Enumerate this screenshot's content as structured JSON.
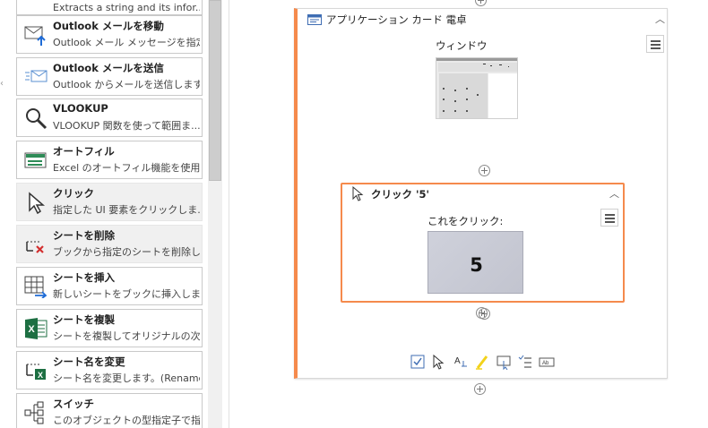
{
  "left_panel": {
    "partial_top_text": "Extracts a string and its infor...",
    "edge_glyph": "‹",
    "activities": [
      {
        "title": "Outlook メールを移動",
        "desc": "Outlook メール メッセージを指定...",
        "icon": "mail-move-icon"
      },
      {
        "title": "Outlook メールを送信",
        "desc": "Outlook からメールを送信します...",
        "icon": "mail-send-icon"
      },
      {
        "title": "VLOOKUP",
        "desc": "VLOOKUP 関数を使って範囲ま...",
        "icon": "magnifier-icon"
      },
      {
        "title": "オートフィル",
        "desc": "Excel のオートフィル機能を使用...",
        "icon": "autofill-icon"
      },
      {
        "title": "クリック",
        "desc": "指定した UI 要素をクリックしま...",
        "icon": "cursor-icon"
      },
      {
        "title": "シートを削除",
        "desc": "ブックから指定のシートを削除し...",
        "icon": "delete-sheet-icon"
      },
      {
        "title": "シートを挿入",
        "desc": "新しいシートをブックに挿入します...",
        "icon": "insert-sheet-icon"
      },
      {
        "title": "シートを複製",
        "desc": "シートを複製してオリジナルの次...",
        "icon": "excel-icon"
      },
      {
        "title": "シート名を変更",
        "desc": "シート名を変更します。(Rename...",
        "icon": "rename-sheet-icon"
      },
      {
        "title": "スイッチ",
        "desc": "このオブジェクトの型指定子で指...",
        "icon": "switch-icon"
      }
    ]
  },
  "app_card": {
    "title": "アプリケーション カード 電卓",
    "window_label": "ウィンドウ",
    "icon": "window-icon",
    "accent": "#f58a4c"
  },
  "click_card": {
    "title": "クリック '5'",
    "target_label": "これをクリック:",
    "button_text": "5",
    "icon": "cursor-icon"
  },
  "toolbar_icons": [
    "checkbox-icon",
    "click-icon",
    "type-into-icon",
    "highlight-icon",
    "hover-icon",
    "check-list-icon",
    "text-field-icon"
  ]
}
